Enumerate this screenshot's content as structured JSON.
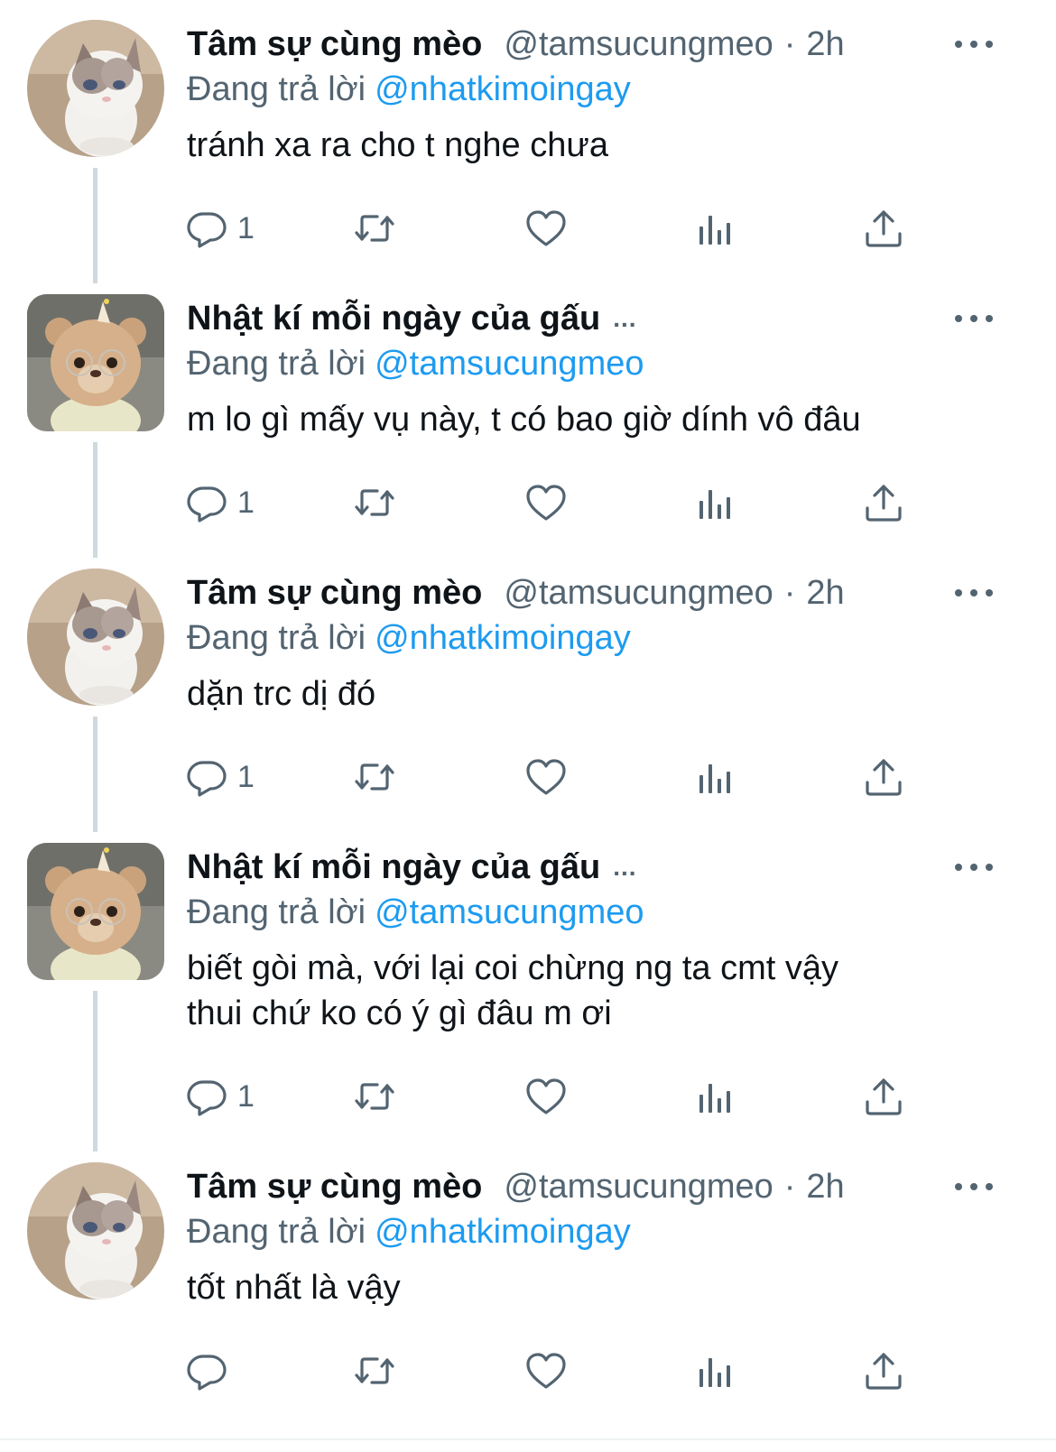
{
  "colors": {
    "accent": "#1d9bf0",
    "secondary_text": "#536471",
    "primary_text": "#0f1419"
  },
  "tweets": [
    {
      "avatar": "cat-avatar",
      "name": "Tâm sự cùng mèo",
      "handle": "@tamsucungmeo",
      "separator": "·",
      "time": "2h",
      "replying_prefix": "Đang trả lời",
      "replying_to": "@nhatkimoingay",
      "text": "tránh xa ra cho t nghe chưa",
      "reply_count": "1"
    },
    {
      "avatar": "bear-avatar",
      "name": "Nhật kí mỗi ngày của gấu",
      "truncation": "...",
      "replying_prefix": "Đang trả lời",
      "replying_to": "@tamsucungmeo",
      "text": "m lo gì mấy vụ này, t có bao giờ dính vô đâu",
      "reply_count": "1"
    },
    {
      "avatar": "cat-avatar",
      "name": "Tâm sự cùng mèo",
      "handle": "@tamsucungmeo",
      "separator": "·",
      "time": "2h",
      "replying_prefix": "Đang trả lời",
      "replying_to": "@nhatkimoingay",
      "text": "dặn trc dị đó",
      "reply_count": "1"
    },
    {
      "avatar": "bear-avatar",
      "name": "Nhật kí mỗi ngày của gấu",
      "truncation": "...",
      "replying_prefix": "Đang trả lời",
      "replying_to": "@tamsucungmeo",
      "text_lines": [
        "biết gòi mà, với lại coi chừng ng ta cmt vậy",
        "thui chứ ko có ý gì đâu m ơi"
      ],
      "reply_count": "1"
    },
    {
      "avatar": "cat-avatar",
      "name": "Tâm sự cùng mèo",
      "handle": "@tamsucungmeo",
      "separator": "·",
      "time": "2h",
      "replying_prefix": "Đang trả lời",
      "replying_to": "@nhatkimoingay",
      "text": "tốt nhất là vậy",
      "reply_count": ""
    }
  ],
  "icons": [
    "reply-icon",
    "retweet-icon",
    "like-icon",
    "views-icon",
    "share-icon",
    "more-icon"
  ]
}
